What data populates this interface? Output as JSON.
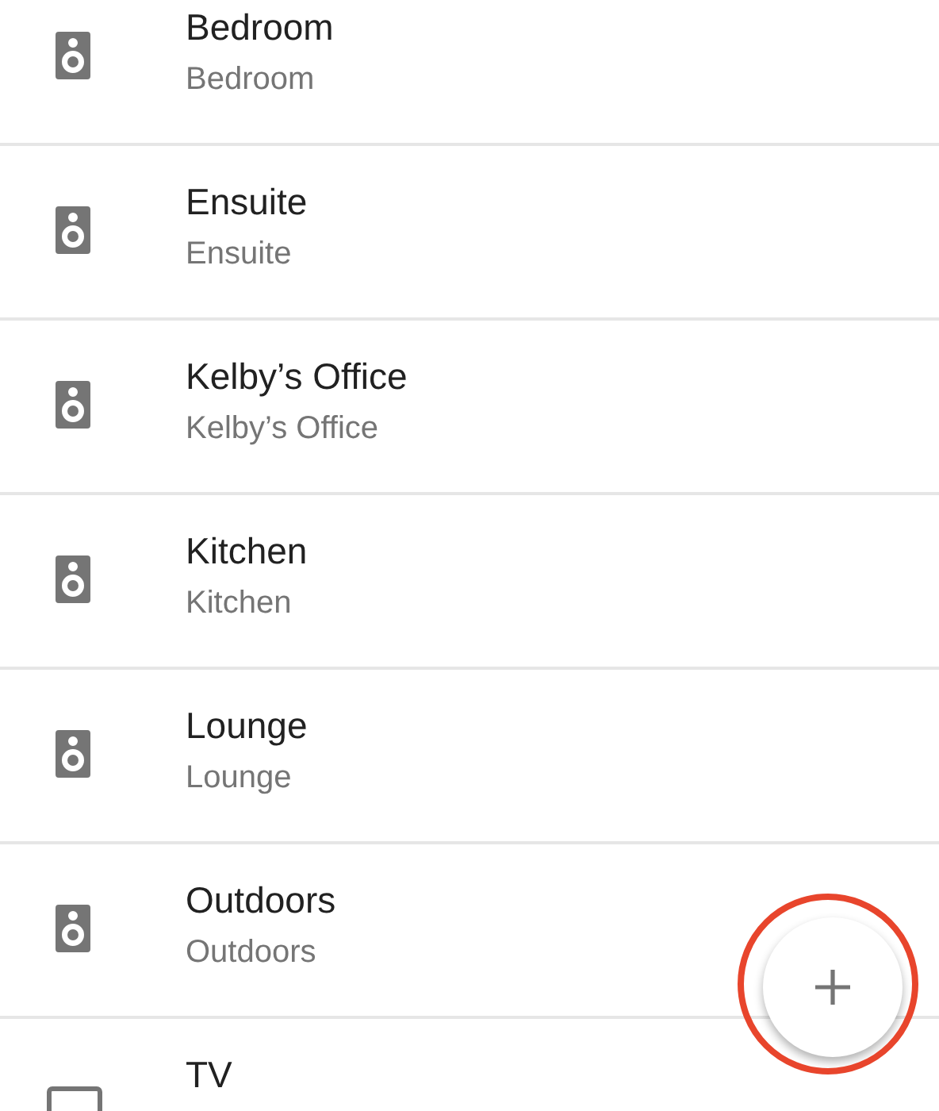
{
  "devices": [
    {
      "kind": "speaker",
      "name": "Bedroom",
      "room": "Bedroom"
    },
    {
      "kind": "speaker",
      "name": "Ensuite",
      "room": "Ensuite"
    },
    {
      "kind": "speaker",
      "name": "Kelby’s Office",
      "room": "Kelby’s Office"
    },
    {
      "kind": "speaker",
      "name": "Kitchen",
      "room": "Kitchen"
    },
    {
      "kind": "speaker",
      "name": "Lounge",
      "room": "Lounge"
    },
    {
      "kind": "speaker",
      "name": "Outdoors",
      "room": "Outdoors"
    },
    {
      "kind": "tv",
      "name": "TV"
    }
  ]
}
